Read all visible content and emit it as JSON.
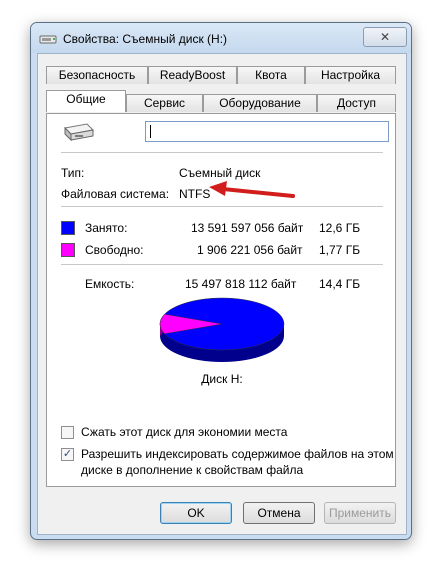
{
  "window": {
    "title": "Свойства: Съемный диск (H:)",
    "close_icon": "✕"
  },
  "tabs": {
    "row1": [
      "Безопасность",
      "ReadyBoost",
      "Квота",
      "Настройка"
    ],
    "row2": [
      "Общие",
      "Сервис",
      "Оборудование",
      "Доступ"
    ],
    "active": "Общие"
  },
  "general": {
    "name_value": "",
    "type_label": "Тип:",
    "type_value": "Съемный диск",
    "fs_label": "Файловая система:",
    "fs_value": "NTFS",
    "used_label": "Занято:",
    "used_bytes": "13 591 597 056 байт",
    "used_size": "12,6 ГБ",
    "free_label": "Свободно:",
    "free_bytes": "1 906 221 056 байт",
    "free_size": "1,77 ГБ",
    "capacity_label": "Емкость:",
    "capacity_bytes": "15 497 818 112 байт",
    "capacity_size": "14,4 ГБ",
    "disk_label": "Диск H:",
    "compress_label": "Сжать этот диск для экономии места",
    "compress_checked": false,
    "index_label_line1": "Разрешить индексировать содержимое файлов на этом",
    "index_label_line2": "диске в дополнение к свойствам файла",
    "index_checked": true,
    "index_check_glyph": "✓",
    "used_color": "#0000ff",
    "free_color": "#ff00ff",
    "used_fraction": 0.877
  },
  "annotation": {
    "arrow_color": "#d21d1d"
  },
  "buttons": {
    "ok": "OK",
    "cancel": "Отмена",
    "apply": "Применить"
  }
}
